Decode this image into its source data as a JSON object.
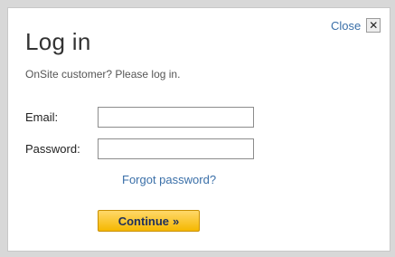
{
  "dialog": {
    "title": "Log in",
    "subtitle": "OnSite customer? Please log in.",
    "close_label": "Close",
    "close_icon_glyph": "✕"
  },
  "form": {
    "email_label": "Email:",
    "email_value": "",
    "password_label": "Password:",
    "password_value": "",
    "forgot_label": "Forgot password?",
    "continue_label": "Continue",
    "continue_icon_glyph": "»"
  },
  "colors": {
    "link": "#3a6fa8",
    "button_top": "#ffd86a",
    "button_bottom": "#f5b800"
  }
}
